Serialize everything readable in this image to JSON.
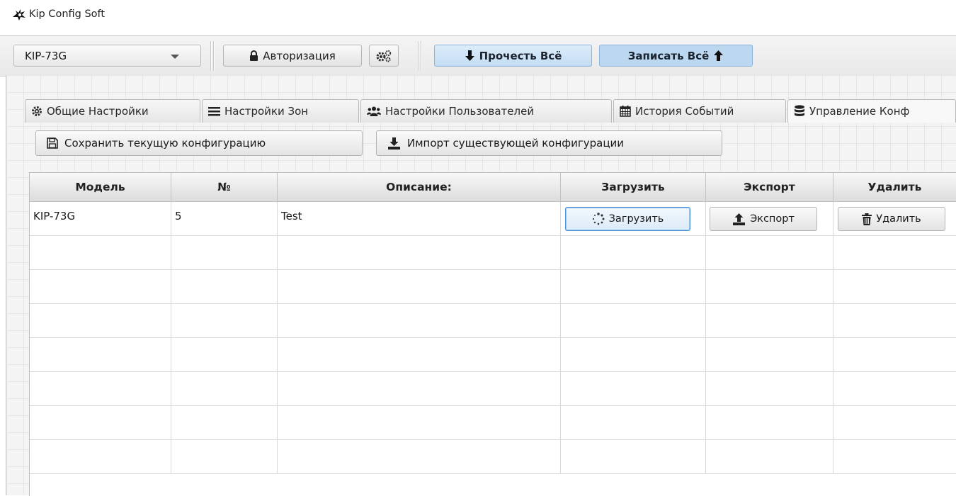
{
  "window": {
    "title": "Kip Config Soft",
    "icon": "app-logo-icon"
  },
  "toolbar": {
    "device_select": {
      "value": "KIP-73G"
    },
    "auth_button": {
      "label": "Авторизация",
      "icon": "lock-icon"
    },
    "settings_button": {
      "icon": "gears-icon"
    },
    "read_all_button": {
      "label": "Прочесть Всё",
      "icon": "arrow-down-icon"
    },
    "write_all_button": {
      "label": "Записать Всё",
      "icon": "arrow-up-icon"
    }
  },
  "tabs": [
    {
      "label": "Общие Настройки",
      "icon": "gear-icon",
      "active": false
    },
    {
      "label": "Настройки Зон",
      "icon": "list-icon",
      "active": false
    },
    {
      "label": "Настройки Пользователей",
      "icon": "users-icon",
      "active": false
    },
    {
      "label": "История Событий",
      "icon": "calendar-icon",
      "active": false
    },
    {
      "label": "Управление Конф",
      "icon": "database-icon",
      "active": true
    }
  ],
  "actions": {
    "save_config": {
      "label": "Сохранить текущую конфигурацию",
      "icon": "save-icon"
    },
    "import_config": {
      "label": "Импорт существующей конфигурации",
      "icon": "download-icon"
    }
  },
  "table": {
    "columns": [
      "Модель",
      "№",
      "Описание:",
      "Загрузить",
      "Экспорт",
      "Удалить"
    ],
    "rows": [
      {
        "model": "KIP-73G",
        "number": "5",
        "description": "Test",
        "load_label": "Загрузить",
        "export_label": "Экспорт",
        "delete_label": "Удалить"
      }
    ],
    "empty_rows": 7
  },
  "colors": {
    "accent": "#4a90d9",
    "toolbar_blue": "#c4ddf3"
  }
}
